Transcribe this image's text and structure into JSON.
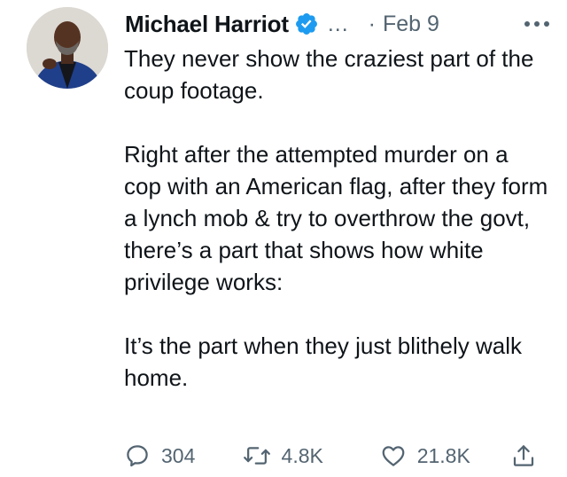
{
  "author": {
    "name": "Michael Harriot",
    "handle": "...",
    "separator": "·",
    "date": "Feb 9",
    "verified": true,
    "avatar": "profile-photo"
  },
  "tweet": {
    "paragraphs": [
      "They never show the craziest part of the coup footage.",
      "Right after the attempted murder on a cop with an American flag, after they form a lynch mob & try to overthrow the govt, there’s a part that shows how white privilege works:",
      "It’s the part when they just blithely walk home."
    ]
  },
  "actions": {
    "reply": {
      "icon": "reply-icon",
      "count": "304"
    },
    "retweet": {
      "icon": "retweet-icon",
      "count": "4.8K"
    },
    "like": {
      "icon": "heart-icon",
      "count": "21.8K"
    },
    "share": {
      "icon": "share-icon"
    }
  },
  "colors": {
    "text": "#0f1419",
    "secondary": "#536471",
    "verified": "#1d9bf0"
  }
}
